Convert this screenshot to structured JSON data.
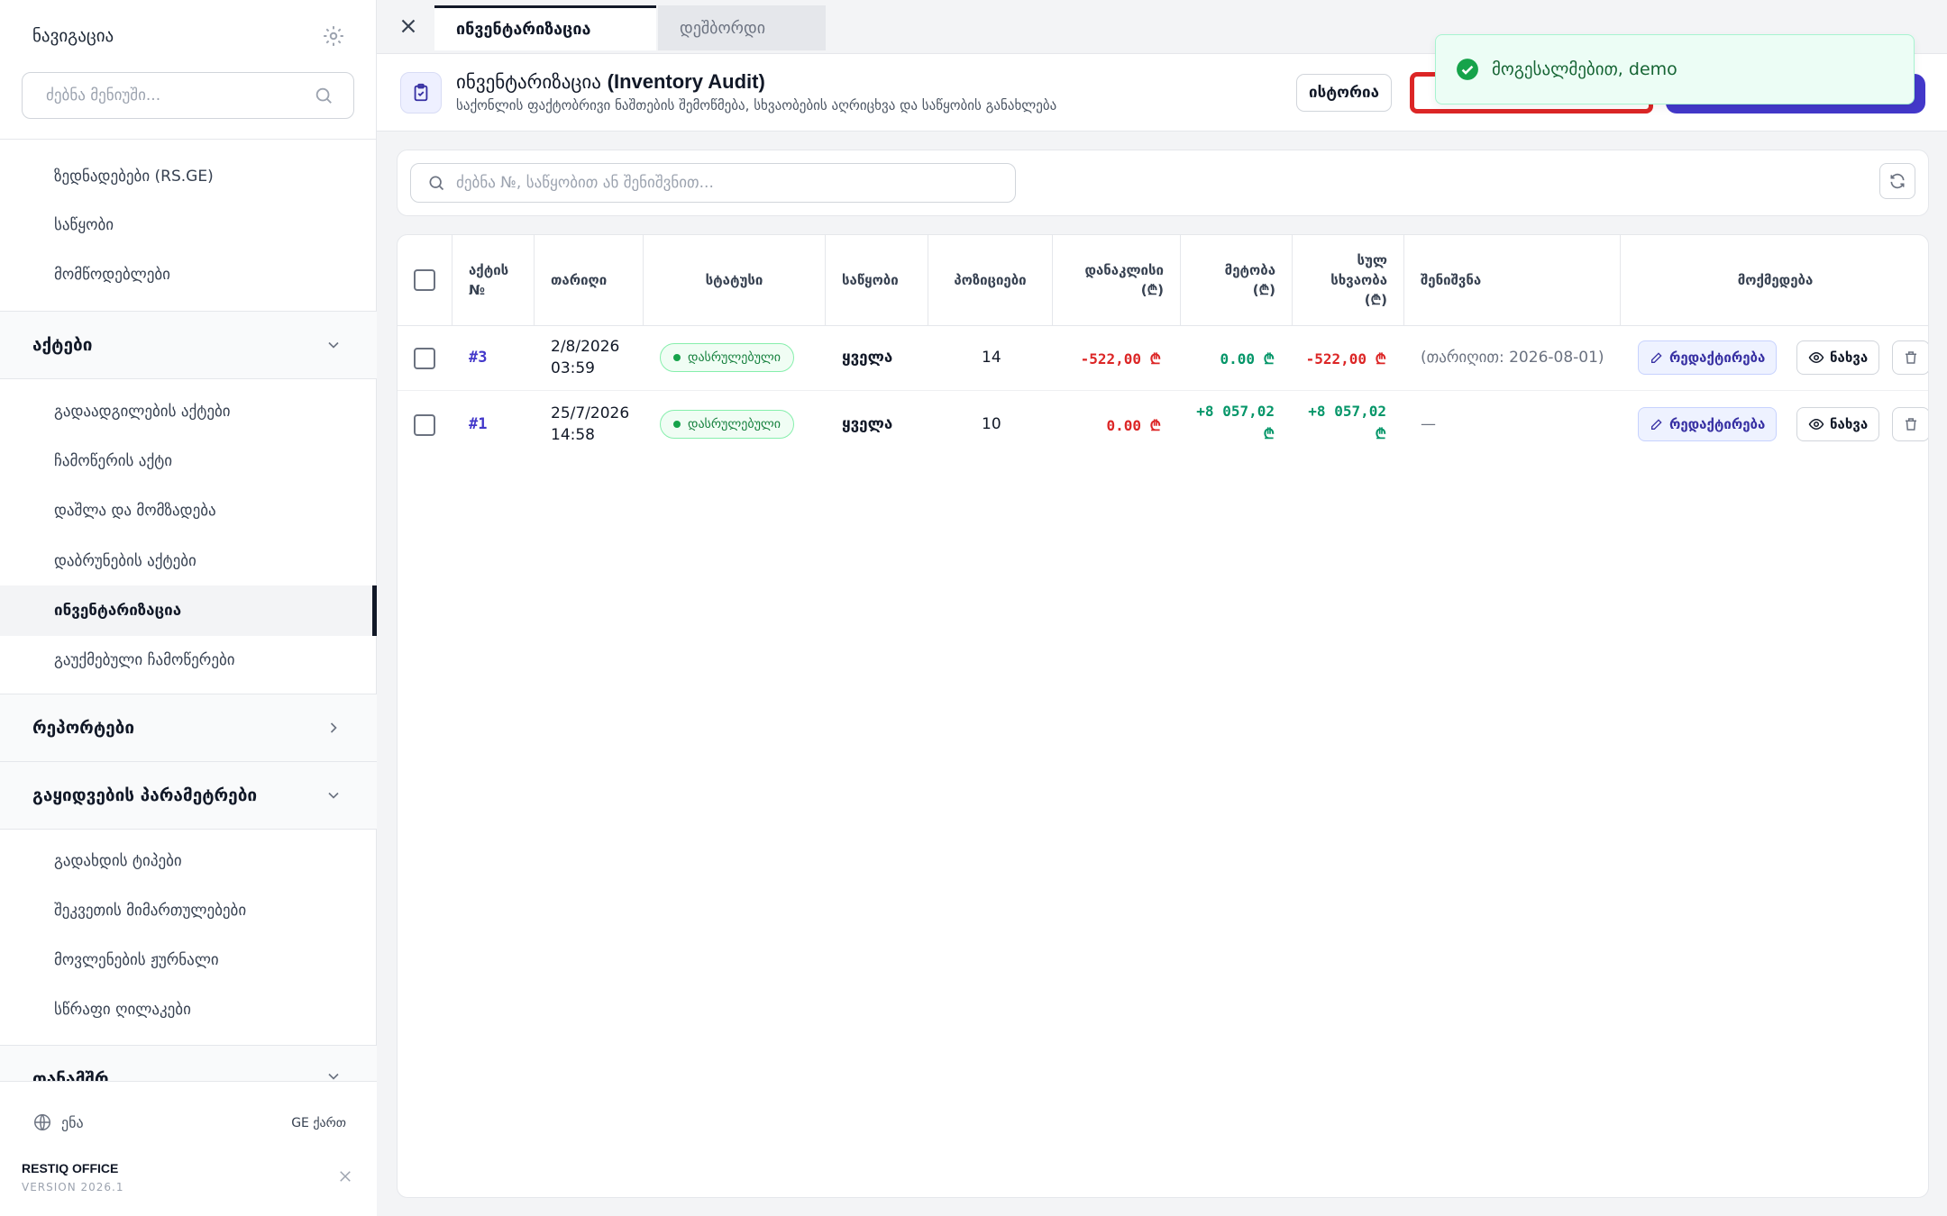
{
  "sidebar": {
    "title": "ნავიგაცია",
    "search_placeholder": "ძებნა მენიუში...",
    "items_top": [
      "ზედნადებები (RS.GE)",
      "საწყობი",
      "მომწოდებლები"
    ],
    "group_acts": "აქტები",
    "acts_items": [
      "გადაადგილების აქტები",
      "ჩამოწერის აქტი",
      "დაშლა და მომზადება",
      "დაბრუნების აქტები",
      "ინვენტარიზაცია",
      "გაუქმებული ჩამოწერები"
    ],
    "group_reports": "რეპორტები",
    "group_sales": "გაყიდვების პარამეტრები",
    "sales_items": [
      "გადახდის ტიპები",
      "შეკვეთის მიმართულებები",
      "მოვლენების ჟურნალი",
      "სწრაფი ღილაკები"
    ],
    "group_partial": "თანამშრ",
    "language_label": "ენა",
    "language_value": "GE ქართ",
    "brand": "RESTIQ OFFICE",
    "version": "VERSION 2026.1"
  },
  "tabs": {
    "active": "ინვენტარიზაცია",
    "inactive": "დეშბორდი"
  },
  "header": {
    "title_ka": "ინვენტარიზაცია",
    "title_en": "(Inventory Audit)",
    "subtitle": "საქონლის ფაქტობრივი ნაშთების შემოწმება, სხვაობების აღრიცხვა და საწყობის განახლება",
    "history_label": "ისტორია"
  },
  "toast": {
    "message": "მოგესალმებით, demo"
  },
  "search": {
    "placeholder": "ძებნა №, საწყობით ან შენიშვნით..."
  },
  "table": {
    "headers": {
      "act_no_1": "აქტის",
      "act_no_2": "№",
      "date": "თარიღი",
      "status": "სტატუსი",
      "warehouse": "საწყობი",
      "positions": "პოზიციები",
      "shortage_1": "დანაკლისი",
      "shortage_2": "(₾)",
      "surplus_1": "მეტობა",
      "surplus_2": "(₾)",
      "total_1": "სულ",
      "total_2": "სხვაობა",
      "total_3": "(₾)",
      "note": "შენიშვნა",
      "actions": "მოქმედება"
    },
    "rows": [
      {
        "no": "#3",
        "date_1": "2/8/2026",
        "date_2": "03:59",
        "status": "დასრულებული",
        "warehouse": "ყველა",
        "positions": "14",
        "shortage": "-522,00 ₾",
        "surplus": "0.00 ₾",
        "total": "-522,00 ₾",
        "note": "(თარიღით: 2026-08-01)",
        "edit": "რედაქტირება",
        "view": "ნახვა"
      },
      {
        "no": "#1",
        "date_1": "25/7/2026",
        "date_2": "14:58",
        "status": "დასრულებული",
        "warehouse": "ყველა",
        "positions": "10",
        "shortage": "0.00 ₾",
        "surplus_1": "+8 057,02",
        "surplus_2": "₾",
        "total_1": "+8 057,02",
        "total_2": "₾",
        "note": "—",
        "edit": "რედაქტირება",
        "view": "ნახვა"
      }
    ]
  },
  "colors": {
    "accent": "#4338ca",
    "negative": "#dc2626",
    "positive": "#059669",
    "status": "#15803d",
    "highlight_border": "#dc2626"
  }
}
